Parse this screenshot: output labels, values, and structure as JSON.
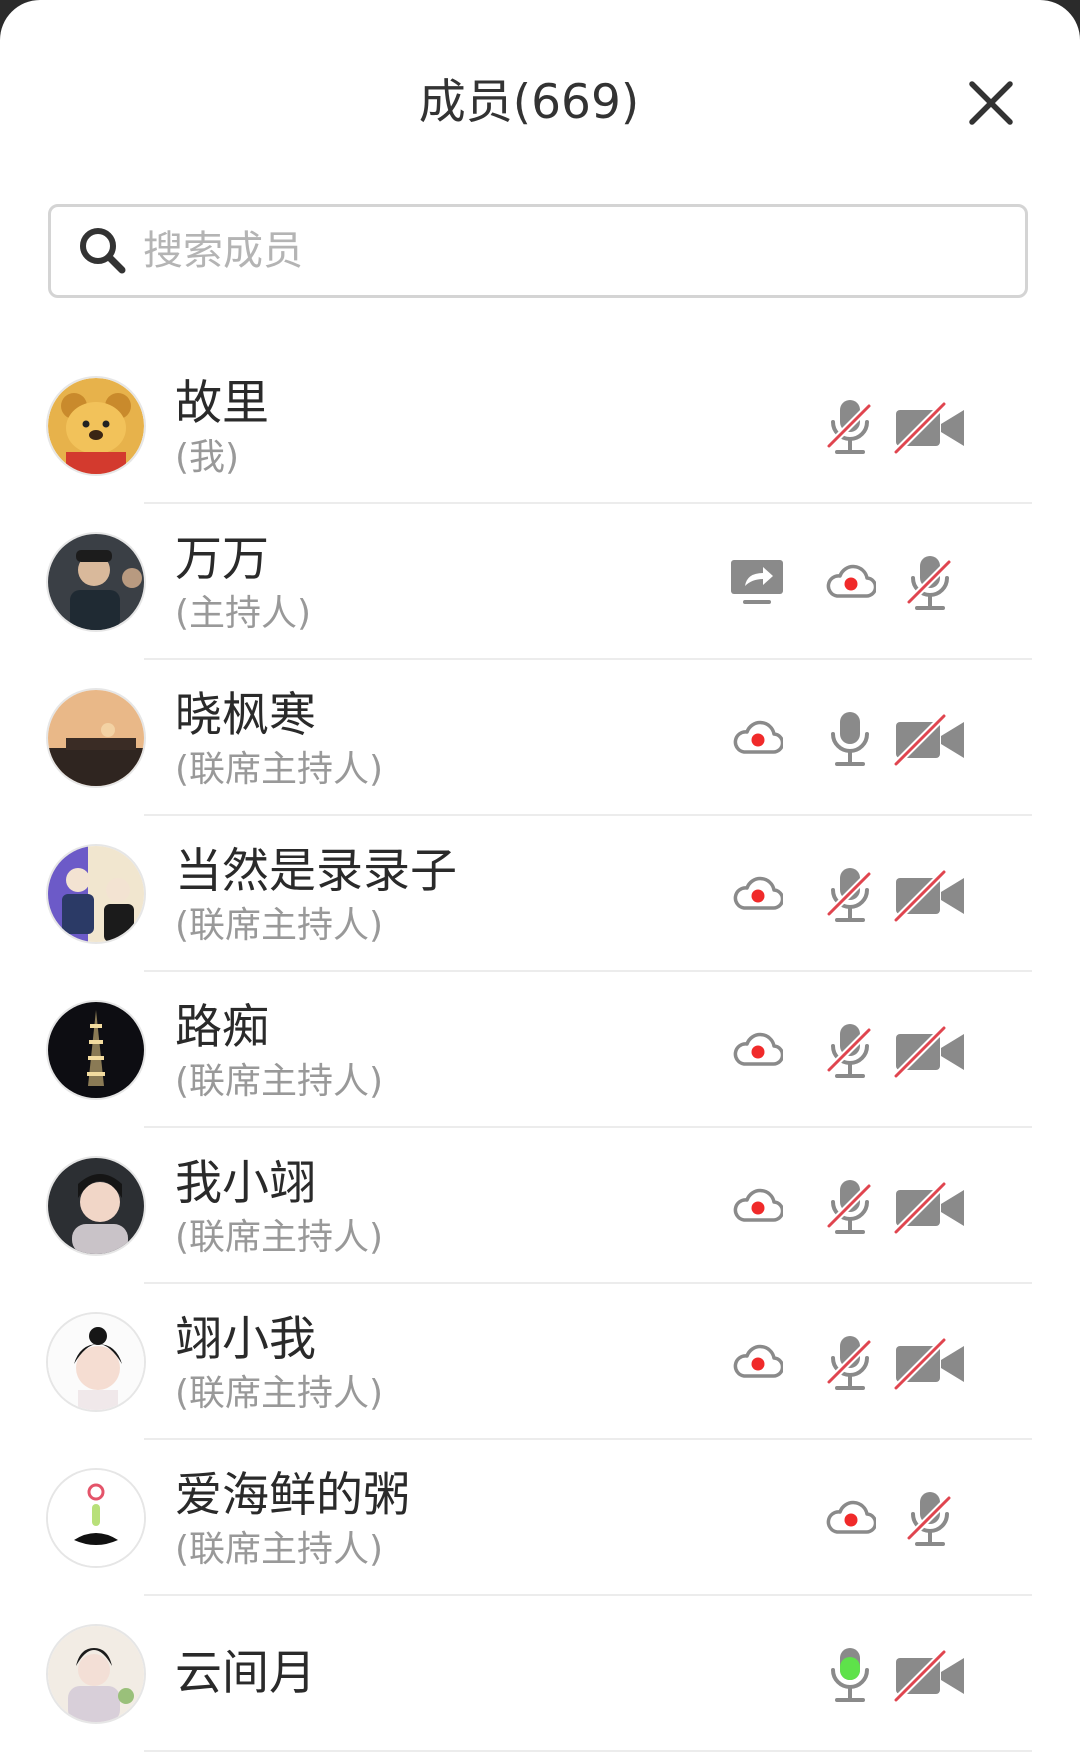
{
  "title": "成员(669)",
  "search": {
    "placeholder": "搜索成员"
  },
  "members": [
    {
      "name": "故里",
      "role": "(我)",
      "icons": [
        "mic-muted",
        "video-off"
      ]
    },
    {
      "name": "万万",
      "role": "(主持人)",
      "icons": [
        "screen-share",
        "cloud-record",
        "mic-muted"
      ]
    },
    {
      "name": "晓枫寒",
      "role": "(联席主持人)",
      "icons": [
        "cloud-record",
        "mic-on",
        "video-off"
      ]
    },
    {
      "name": "当然是录录子",
      "role": "(联席主持人)",
      "icons": [
        "cloud-record",
        "mic-muted",
        "video-off"
      ]
    },
    {
      "name": "路痴",
      "role": "(联席主持人)",
      "icons": [
        "cloud-record",
        "mic-muted",
        "video-off"
      ]
    },
    {
      "name": "我小翊",
      "role": "(联席主持人)",
      "icons": [
        "cloud-record",
        "mic-muted",
        "video-off"
      ]
    },
    {
      "name": "翊小我",
      "role": "(联席主持人)",
      "icons": [
        "cloud-record",
        "mic-muted",
        "video-off"
      ]
    },
    {
      "name": "爱海鲜的粥",
      "role": "(联席主持人)",
      "icons": [
        "cloud-record",
        "mic-muted"
      ]
    },
    {
      "name": "云间月",
      "role": "",
      "icons": [
        "mic-speaking",
        "video-off"
      ]
    }
  ],
  "colors": {
    "muted_slash": "#e0454f",
    "record_dot": "#f02a2a",
    "speaking": "#5ee24a",
    "icon_gray": "#8a8a8a"
  }
}
